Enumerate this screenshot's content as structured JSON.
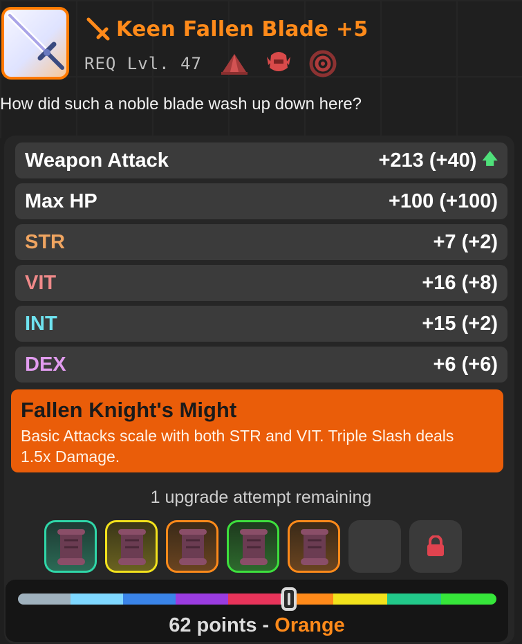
{
  "item": {
    "name": "Keen Fallen Blade +5",
    "requirement": "REQ Lvl. 47",
    "description": "How did such a noble blade wash up down here?",
    "rarity_color": "#ff8a1a",
    "icon": "sword-icon",
    "class_icons": [
      "tent-icon",
      "helmet-icon",
      "swirl-icon"
    ]
  },
  "stats": [
    {
      "label": "Weapon Attack",
      "value": "+213 (+40)",
      "label_color": "#ffffff",
      "trend": "up"
    },
    {
      "label": "Max HP",
      "value": "+100 (+100)",
      "label_color": "#ffffff"
    },
    {
      "label": "STR",
      "value": "+7 (+2)",
      "label_color": "#f0a561"
    },
    {
      "label": "VIT",
      "value": "+16 (+8)",
      "label_color": "#f08a8a"
    },
    {
      "label": "INT",
      "value": "+15 (+2)",
      "label_color": "#6fe3f0"
    },
    {
      "label": "DEX",
      "value": "+6 (+6)",
      "label_color": "#e29cf0"
    }
  ],
  "ability": {
    "name": "Fallen Knight's Might",
    "description": "Basic Attacks scale with both STR and VIT. Triple Slash deals 1.5x Damage."
  },
  "upgrade": {
    "remaining_text": "1 upgrade attempt remaining",
    "slots": [
      {
        "state": "used",
        "color": "#2fd6a8"
      },
      {
        "state": "used",
        "color": "#f2e21c"
      },
      {
        "state": "used",
        "color": "#ff8a1a"
      },
      {
        "state": "used",
        "color": "#3de03d"
      },
      {
        "state": "used",
        "color": "#ff8a1a"
      },
      {
        "state": "empty"
      },
      {
        "state": "locked"
      }
    ]
  },
  "quality": {
    "points_prefix": "62 points - ",
    "tier": "Orange",
    "tier_color": "#ff8a1a",
    "value": 62,
    "segments": [
      "#9fb1bd",
      "#7fd8ff",
      "#3a84e8",
      "#9a3ce0",
      "#e8345a",
      "#f0f0f0",
      "#ff8a1a",
      "#f2e21c",
      "#22c98a",
      "#36e63a"
    ]
  }
}
